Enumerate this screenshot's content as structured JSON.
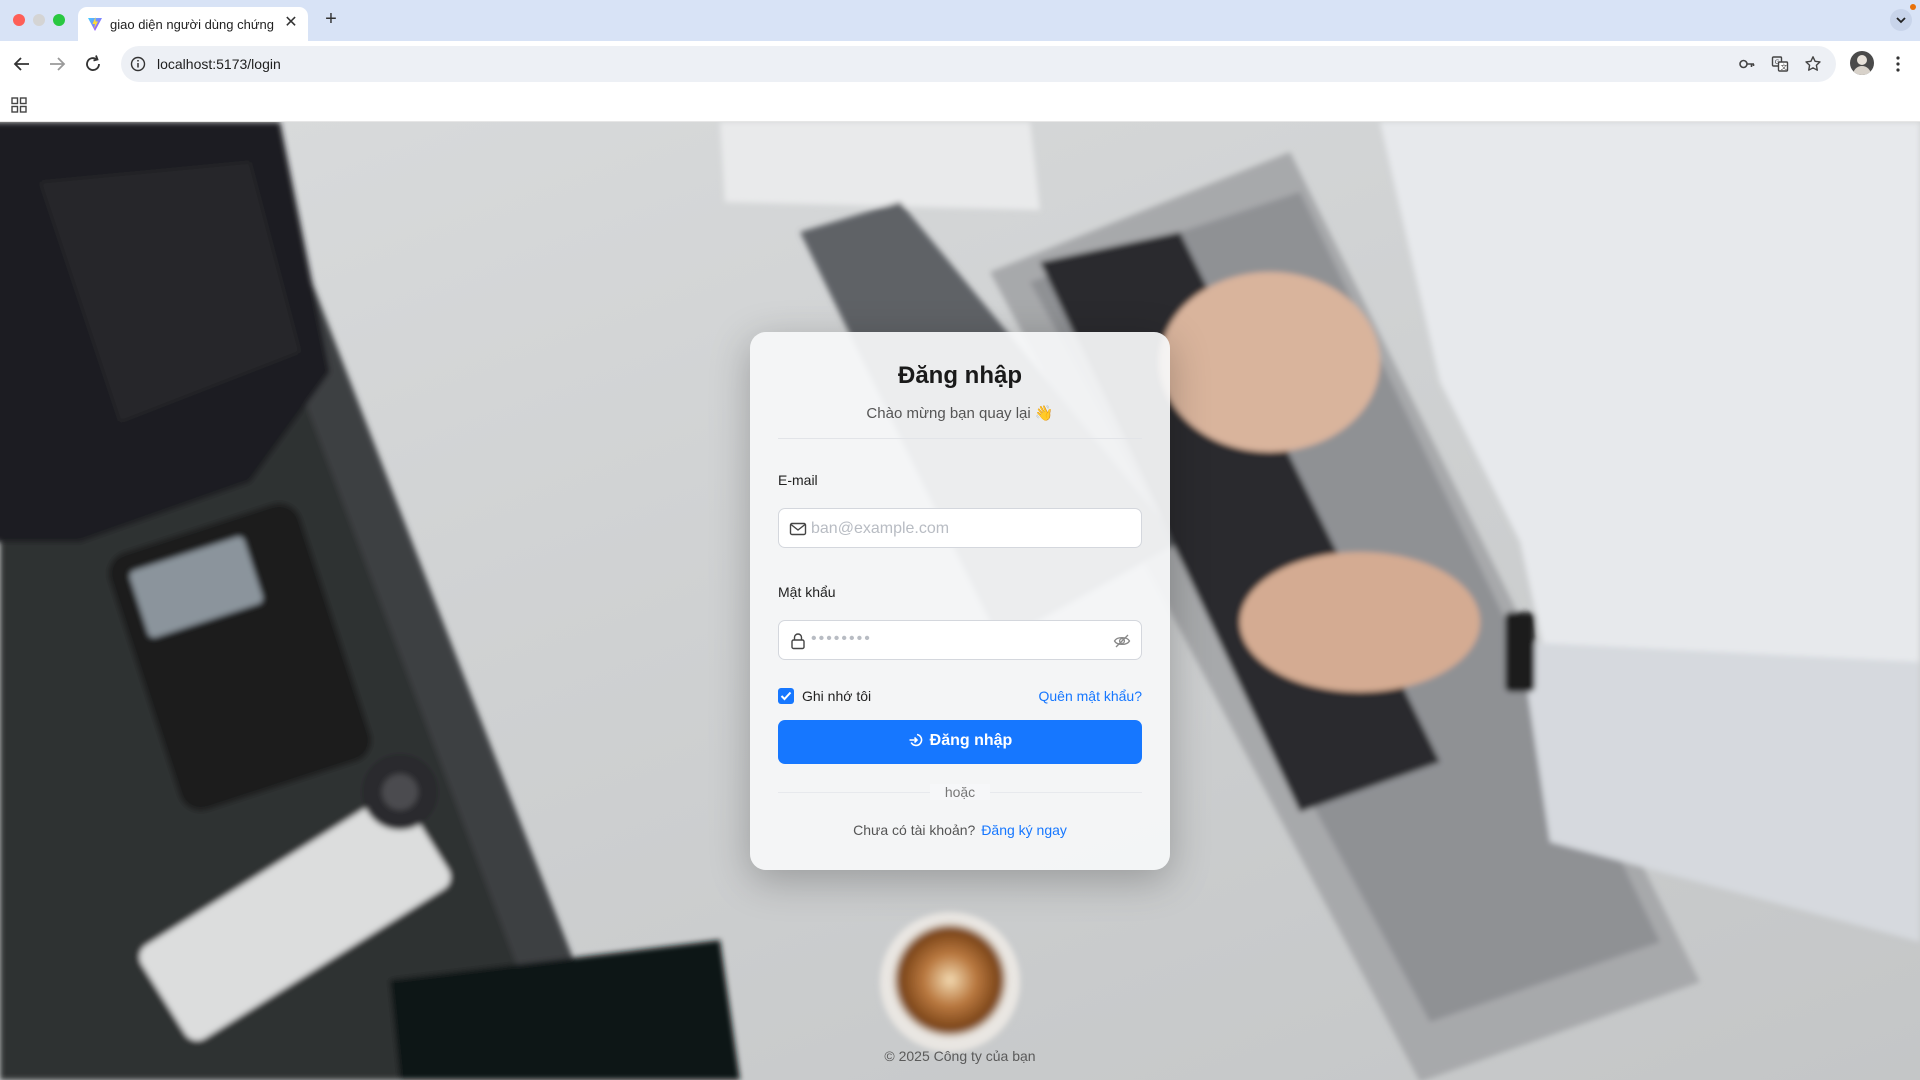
{
  "browser": {
    "tab_title": "giao diện người dùng chứng k",
    "url": "localhost:5173/login"
  },
  "login": {
    "title": "Đăng nhập",
    "subtitle": "Chào mừng bạn quay lại 👋",
    "email_label": "E-mail",
    "email_placeholder": "ban@example.com",
    "password_label": "Mật khẩu",
    "password_masked": "••••••••",
    "remember_label": "Ghi nhớ tôi",
    "remember_checked": true,
    "forgot_link": "Quên mật khẩu?",
    "submit_label": "Đăng nhập",
    "divider_text": "hoặc",
    "no_account_text": "Chưa có tài khoản?",
    "signup_link": "Đăng ký ngay"
  },
  "footer": {
    "copyright": "© 2025 Công ty của bạn"
  },
  "colors": {
    "primary": "#1677ff",
    "tabbar": "#d8e3f6"
  }
}
